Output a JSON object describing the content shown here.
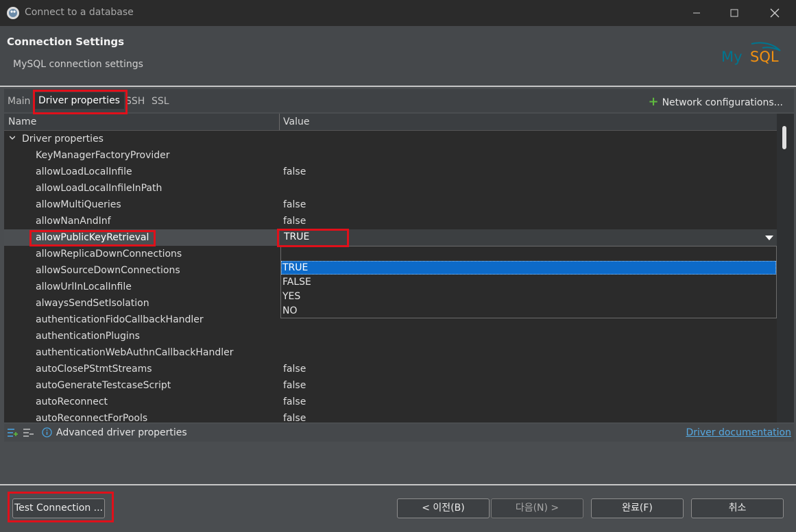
{
  "window": {
    "title": "Connect to a database"
  },
  "header": {
    "title": "Connection Settings",
    "subtitle": "MySQL connection settings",
    "logo_text": "MySQL"
  },
  "tabs": [
    {
      "label": "Main"
    },
    {
      "label": "Driver properties",
      "active": true
    },
    {
      "label": "SSH"
    },
    {
      "label": "SSL"
    }
  ],
  "network_config_label": "Network configurations...",
  "grid": {
    "columns": [
      "Name",
      "Value"
    ],
    "group": "Driver properties",
    "rows": [
      {
        "name": "KeyManagerFactoryProvider",
        "value": ""
      },
      {
        "name": "allowLoadLocalInfile",
        "value": "false"
      },
      {
        "name": "allowLoadLocalInfileInPath",
        "value": ""
      },
      {
        "name": "allowMultiQueries",
        "value": "false"
      },
      {
        "name": "allowNanAndInf",
        "value": "false"
      },
      {
        "name": "allowPublicKeyRetrieval",
        "value": "TRUE",
        "selected": true
      },
      {
        "name": "allowReplicaDownConnections",
        "value": ""
      },
      {
        "name": "allowSourceDownConnections",
        "value": ""
      },
      {
        "name": "allowUrlInLocalInfile",
        "value": ""
      },
      {
        "name": "alwaysSendSetIsolation",
        "value": ""
      },
      {
        "name": "authenticationFidoCallbackHandler",
        "value": ""
      },
      {
        "name": "authenticationPlugins",
        "value": ""
      },
      {
        "name": "authenticationWebAuthnCallbackHandler",
        "value": ""
      },
      {
        "name": "autoClosePStmtStreams",
        "value": "false"
      },
      {
        "name": "autoGenerateTestcaseScript",
        "value": "false"
      },
      {
        "name": "autoReconnect",
        "value": "false"
      },
      {
        "name": "autoReconnectForPools",
        "value": "false"
      }
    ]
  },
  "combo": {
    "value": "TRUE",
    "options": [
      "TRUE",
      "FALSE",
      "YES",
      "NO"
    ],
    "highlighted": "TRUE"
  },
  "statusbar": {
    "advanced_label": "Advanced driver properties",
    "doc_link": "Driver documentation"
  },
  "buttons": {
    "test": "Test Connection ...",
    "back": "< 이전(B)",
    "next": "다음(N) >",
    "finish": "완료(F)",
    "cancel": "취소"
  },
  "colors": {
    "highlight_box": "#e0101a",
    "selection": "#0d6ac8",
    "link": "#56a8e0",
    "plus": "#5fba3f",
    "logo_my": "#00758f",
    "logo_sql": "#f29111"
  }
}
